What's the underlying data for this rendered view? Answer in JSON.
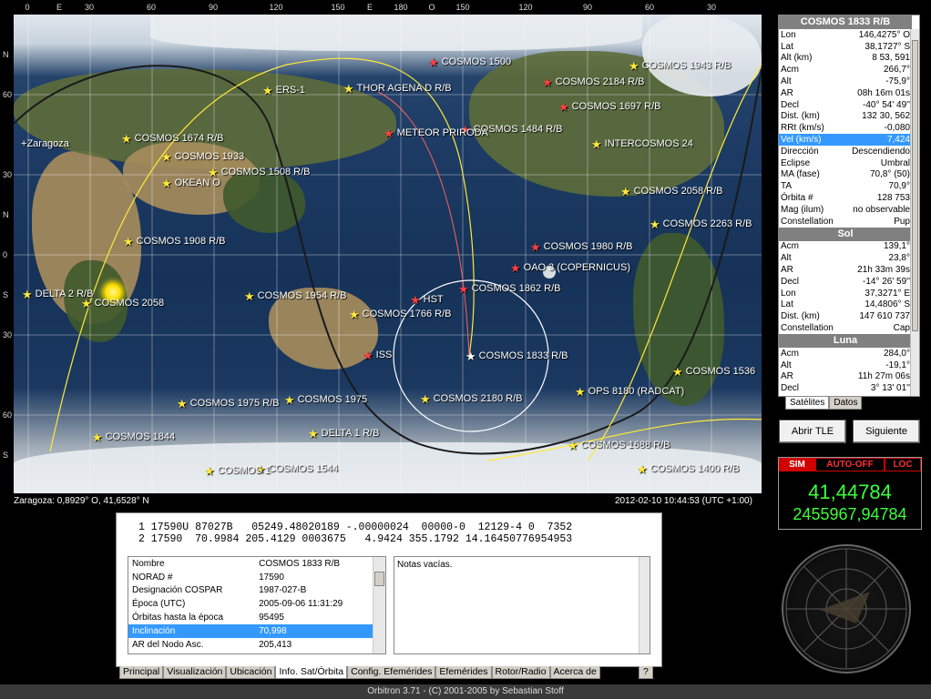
{
  "top_scale": [
    "0",
    "E",
    "30",
    "60",
    "90",
    "120",
    "150",
    "E",
    "180",
    "O",
    "150",
    "120",
    "90",
    "60",
    "30"
  ],
  "left_scale": [
    "N",
    "60",
    "30",
    "N",
    "0",
    "S",
    "30",
    "60",
    "S"
  ],
  "map": {
    "satellites": [
      {
        "name": "COSMOS 1500",
        "color": "red"
      },
      {
        "name": "COSMOS 1943 R/B",
        "color": "yellow"
      },
      {
        "name": "ERS-1",
        "color": "yellow"
      },
      {
        "name": "THOR AGENA D R/B",
        "color": "yellow"
      },
      {
        "name": "COSMOS 2184 R/B",
        "color": "red"
      },
      {
        "name": "COSMOS 1697 R/B",
        "color": "red"
      },
      {
        "name": "COSMOS 1484 R/B",
        "color": "red"
      },
      {
        "name": "METEOR PRIRODA",
        "color": "red"
      },
      {
        "name": "COSMOS 1674 R/B",
        "color": "yellow"
      },
      {
        "name": "COSMOS 1933",
        "color": "yellow"
      },
      {
        "name": "COSMOS 1508 R/B",
        "color": "yellow"
      },
      {
        "name": "OKEAN O",
        "color": "yellow"
      },
      {
        "name": "INTERCOSMOS 24",
        "color": "yellow"
      },
      {
        "name": "COSMOS 2058 R/B",
        "color": "yellow"
      },
      {
        "name": "COSMOS 2263 R/B",
        "color": "yellow"
      },
      {
        "name": "COSMOS 1908 R/B",
        "color": "yellow"
      },
      {
        "name": "COSMOS 1980 R/B",
        "color": "red"
      },
      {
        "name": "OAO 3 (COPERNICUS)",
        "color": "red"
      },
      {
        "name": "DELTA 2 R/B",
        "color": "yellow"
      },
      {
        "name": "COSMOS 2058",
        "color": "yellow"
      },
      {
        "name": "COSMOS 1954 R/B",
        "color": "yellow"
      },
      {
        "name": "HST",
        "color": "red"
      },
      {
        "name": "COSMOS 1862 R/B",
        "color": "red"
      },
      {
        "name": "COSMOS 1766 R/B",
        "color": "yellow"
      },
      {
        "name": "ISS",
        "color": "red"
      },
      {
        "name": "COSMOS 1833 R/B",
        "color": "white"
      },
      {
        "name": "COSMOS 1536",
        "color": "yellow"
      },
      {
        "name": "OPS 8180 (RADCAT)",
        "color": "yellow"
      },
      {
        "name": "COSMOS 1975 R/B",
        "color": "yellow"
      },
      {
        "name": "COSMOS 1975",
        "color": "yellow"
      },
      {
        "name": "COSMOS 2180 R/B",
        "color": "yellow"
      },
      {
        "name": "COSMOS 1844",
        "color": "yellow"
      },
      {
        "name": "DELTA 1 R/B",
        "color": "yellow"
      },
      {
        "name": "COSMOS 1688 R/B",
        "color": "yellow"
      },
      {
        "name": "COSMOS 1544",
        "color": "yellow"
      },
      {
        "name": "COSMOS 1400 R/B",
        "color": "yellow"
      },
      {
        "name": "COSMOS 1",
        "color": "yellow"
      }
    ],
    "location_label": "Zaragoza",
    "status_left": "Zaragoza: 0,8929° O, 41,6528° N",
    "status_right": "2012-02-10 10:44:53 (UTC +1:00)"
  },
  "right_panel": {
    "title": "COSMOS 1833 R/B",
    "sat_rows": [
      [
        "Lon",
        "146,4275° O"
      ],
      [
        "Lat",
        "38,1727° S"
      ],
      [
        "Alt (km)",
        "8 53, 591"
      ],
      [
        "Acm",
        "266,7°"
      ],
      [
        "Alt",
        "-75,9°"
      ],
      [
        "AR",
        "08h 16m 01s"
      ],
      [
        "Decl",
        "-40° 54' 49''"
      ],
      [
        "Dist. (km)",
        "132 30, 562"
      ],
      [
        "RRt (km/s)",
        "-0,080"
      ],
      [
        "Vel (km/s)",
        "7,424"
      ],
      [
        "Dirección",
        "Descendiendo"
      ],
      [
        "Eclipse",
        "Umbral"
      ],
      [
        "MA (fase)",
        "70,8° (50)"
      ],
      [
        "TA",
        "70,9°"
      ],
      [
        "Órbita #",
        "128 753"
      ],
      [
        "Mag (ilum)",
        "no observable"
      ],
      [
        "Constellation",
        "Pup"
      ]
    ],
    "sun_title": "Sol",
    "sun_rows": [
      [
        "Acm",
        "139,1°"
      ],
      [
        "Alt",
        "23,8°"
      ],
      [
        "AR",
        "21h 33m 39s"
      ],
      [
        "Decl",
        "-14° 26' 59''"
      ],
      [
        "Lon",
        "37,3271° E"
      ],
      [
        "Lat",
        "14,4806° S"
      ],
      [
        "Dist. (km)",
        "147 610 737"
      ],
      [
        "Constellation",
        "Cap"
      ]
    ],
    "moon_title": "Luna",
    "moon_rows": [
      [
        "Acm",
        "284,0°"
      ],
      [
        "Alt",
        "-19,1°"
      ],
      [
        "AR",
        "11h 27m 06s"
      ],
      [
        "Decl",
        "3° 13' 01''"
      ]
    ],
    "tabs": [
      "Satélites",
      "Datos"
    ]
  },
  "buttons": {
    "open_tle": "Abrir TLE",
    "next": "Siguiente"
  },
  "sim": {
    "sim": "SIM",
    "auto_off": "AUTO-OFF",
    "loc": "LOC",
    "value1": "41,44784",
    "value2": "2455967,94784"
  },
  "info": {
    "tle_line1": "1 17590U 87027B   05249.48020189 -.00000024  00000-0  12129-4 0  7352",
    "tle_line2": "2 17590  70.9984 205.4129 0003675   4.9424 355.1792 14.16450776954953",
    "props": [
      [
        "Nombre",
        "COSMOS 1833 R/B"
      ],
      [
        "NORAD #",
        "17590"
      ],
      [
        "Designación COSPAR",
        "1987-027-B"
      ],
      [
        "Época (UTC)",
        "2005-09-06 11:31:29"
      ],
      [
        "Órbitas hasta la época",
        "95495"
      ],
      [
        "Inclinación",
        "70,998"
      ],
      [
        "AR del Nodo Asc.",
        "205,413"
      ]
    ],
    "notes": "Notas vacías."
  },
  "bottom_tabs": [
    "Principal",
    "Visualización",
    "Ubicación",
    "Info. Sat/Órbita",
    "Config. Efemérides",
    "Efemérides",
    "Rotor/Radio",
    "Acerca de"
  ],
  "help_tab": "?",
  "footer": "Orbitron 3.71 - (C) 2001-2005 by Sebastian Stoff"
}
